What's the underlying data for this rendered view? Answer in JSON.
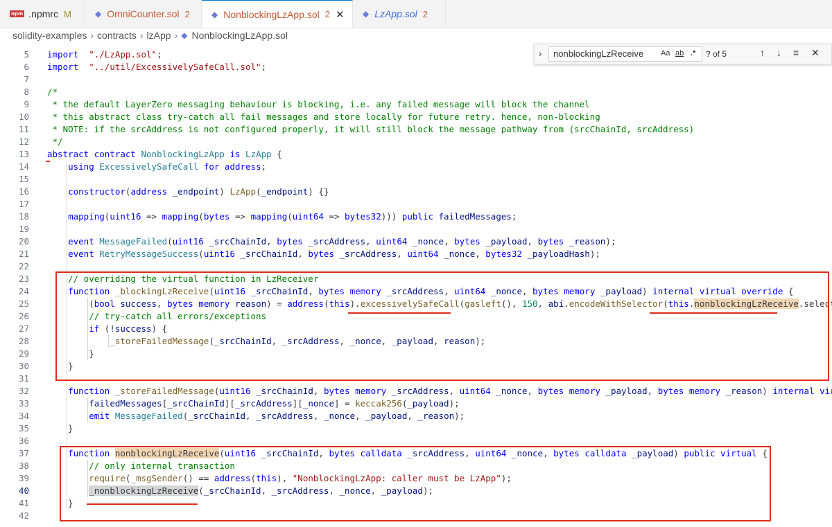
{
  "tabs": [
    {
      "icon": "npm-icon",
      "label": ".npmrc",
      "mod": "M"
    },
    {
      "icon": "solidity-icon",
      "label": "OmniCounter.sol",
      "mod": "2"
    },
    {
      "icon": "solidity-icon",
      "label": "NonblockingLzApp.sol",
      "mod": "2",
      "close": "✕"
    },
    {
      "icon": "solidity-icon",
      "label": "LzApp.sol",
      "mod": "2"
    }
  ],
  "breadcrumb": [
    "solidity-examples",
    "contracts",
    "lzApp",
    "NonblockingLzApp.sol"
  ],
  "find": {
    "query": "nonblockingLzReceive",
    "match_case": "Aa",
    "whole_word": "ab",
    "regex": ".*",
    "count": "? of 5"
  },
  "lines": [
    {
      "n": "5",
      "parts": [
        [
          "k",
          "import"
        ],
        [
          "",
          "  "
        ],
        [
          "s",
          "\"./LzApp.sol\""
        ],
        [
          "",
          ";"
        ]
      ]
    },
    {
      "n": "6",
      "parts": [
        [
          "k",
          "import"
        ],
        [
          "",
          "  "
        ],
        [
          "s",
          "\"../util/ExcessivelySafeCall.sol\""
        ],
        [
          "",
          ";"
        ]
      ]
    },
    {
      "n": "7",
      "parts": []
    },
    {
      "n": "8",
      "parts": [
        [
          "c",
          "/*"
        ]
      ]
    },
    {
      "n": "9",
      "parts": [
        [
          "c",
          " * the default LayerZero messaging behaviour is blocking, i.e. any failed message will block the channel"
        ]
      ]
    },
    {
      "n": "10",
      "parts": [
        [
          "c",
          " * this abstract class try-catch all fail messages and store locally for future retry. hence, non-blocking"
        ]
      ]
    },
    {
      "n": "11",
      "parts": [
        [
          "c",
          " * NOTE: if the srcAddress is not configured properly, it will still block the message pathway from (srcChainId, srcAddress)"
        ]
      ]
    },
    {
      "n": "12",
      "parts": [
        [
          "c",
          " */"
        ]
      ]
    },
    {
      "n": "13",
      "parts": [
        [
          "k",
          "abstract"
        ],
        [
          "",
          " "
        ],
        [
          "k",
          "contract"
        ],
        [
          "",
          " "
        ],
        [
          "t",
          "NonblockingLzApp"
        ],
        [
          "",
          " "
        ],
        [
          "k",
          "is"
        ],
        [
          "",
          " "
        ],
        [
          "t",
          "LzApp"
        ],
        [
          "",
          " {"
        ]
      ]
    },
    {
      "n": "14",
      "parts": [
        [
          "",
          "    "
        ],
        [
          "k",
          "using"
        ],
        [
          "",
          " "
        ],
        [
          "t",
          "ExcessivelySafeCall"
        ],
        [
          "",
          " "
        ],
        [
          "k",
          "for"
        ],
        [
          "",
          " "
        ],
        [
          "k",
          "address"
        ],
        [
          "",
          ";"
        ]
      ]
    },
    {
      "n": "15",
      "parts": []
    },
    {
      "n": "16",
      "parts": [
        [
          "",
          "    "
        ],
        [
          "k",
          "constructor"
        ],
        [
          "",
          "("
        ],
        [
          "k",
          "address"
        ],
        [
          "",
          " "
        ],
        [
          "p",
          "_endpoint"
        ],
        [
          "",
          ") "
        ],
        [
          "f",
          "LzApp"
        ],
        [
          "",
          "("
        ],
        [
          "p",
          "_endpoint"
        ],
        [
          "",
          ") {}"
        ]
      ]
    },
    {
      "n": "17",
      "parts": []
    },
    {
      "n": "18",
      "parts": [
        [
          "",
          "    "
        ],
        [
          "k",
          "mapping"
        ],
        [
          "",
          "("
        ],
        [
          "k",
          "uint16"
        ],
        [
          "",
          " => "
        ],
        [
          "k",
          "mapping"
        ],
        [
          "",
          "("
        ],
        [
          "k",
          "bytes"
        ],
        [
          "",
          " => "
        ],
        [
          "k",
          "mapping"
        ],
        [
          "",
          "("
        ],
        [
          "k",
          "uint64"
        ],
        [
          "",
          " => "
        ],
        [
          "k",
          "bytes32"
        ],
        [
          "",
          ")))"
        ],
        [
          "",
          " "
        ],
        [
          "k",
          "public"
        ],
        [
          "",
          " "
        ],
        [
          "p",
          "failedMessages"
        ],
        [
          "",
          ";"
        ]
      ]
    },
    {
      "n": "19",
      "parts": []
    },
    {
      "n": "20",
      "parts": [
        [
          "",
          "    "
        ],
        [
          "k",
          "event"
        ],
        [
          "",
          " "
        ],
        [
          "t",
          "MessageFailed"
        ],
        [
          "",
          "("
        ],
        [
          "k",
          "uint16"
        ],
        [
          "",
          " "
        ],
        [
          "p",
          "_srcChainId"
        ],
        [
          "",
          ", "
        ],
        [
          "k",
          "bytes"
        ],
        [
          "",
          " "
        ],
        [
          "p",
          "_srcAddress"
        ],
        [
          "",
          ", "
        ],
        [
          "k",
          "uint64"
        ],
        [
          "",
          " "
        ],
        [
          "p",
          "_nonce"
        ],
        [
          "",
          ", "
        ],
        [
          "k",
          "bytes"
        ],
        [
          "",
          " "
        ],
        [
          "p",
          "_payload"
        ],
        [
          "",
          ", "
        ],
        [
          "k",
          "bytes"
        ],
        [
          "",
          " "
        ],
        [
          "p",
          "_reason"
        ],
        [
          "",
          ");"
        ]
      ]
    },
    {
      "n": "21",
      "parts": [
        [
          "",
          "    "
        ],
        [
          "k",
          "event"
        ],
        [
          "",
          " "
        ],
        [
          "t",
          "RetryMessageSuccess"
        ],
        [
          "",
          "("
        ],
        [
          "k",
          "uint16"
        ],
        [
          "",
          " "
        ],
        [
          "p",
          "_srcChainId"
        ],
        [
          "",
          ", "
        ],
        [
          "k",
          "bytes"
        ],
        [
          "",
          " "
        ],
        [
          "p",
          "_srcAddress"
        ],
        [
          "",
          ", "
        ],
        [
          "k",
          "uint64"
        ],
        [
          "",
          " "
        ],
        [
          "p",
          "_nonce"
        ],
        [
          "",
          ", "
        ],
        [
          "k",
          "bytes32"
        ],
        [
          "",
          " "
        ],
        [
          "p",
          "_payloadHash"
        ],
        [
          "",
          ");"
        ]
      ]
    },
    {
      "n": "22",
      "parts": []
    },
    {
      "n": "23",
      "parts": [
        [
          "",
          "    "
        ],
        [
          "c",
          "// overriding the virtual function in LzReceiver"
        ]
      ]
    },
    {
      "n": "24",
      "parts": [
        [
          "",
          "    "
        ],
        [
          "k",
          "function"
        ],
        [
          "",
          " "
        ],
        [
          "f",
          "_blockingLzReceive"
        ],
        [
          "",
          "("
        ],
        [
          "k",
          "uint16"
        ],
        [
          "",
          " "
        ],
        [
          "p",
          "_srcChainId"
        ],
        [
          "",
          ", "
        ],
        [
          "k",
          "bytes"
        ],
        [
          "",
          " "
        ],
        [
          "k",
          "memory"
        ],
        [
          "",
          " "
        ],
        [
          "p",
          "_srcAddress"
        ],
        [
          "",
          ", "
        ],
        [
          "k",
          "uint64"
        ],
        [
          "",
          " "
        ],
        [
          "p",
          "_nonce"
        ],
        [
          "",
          ", "
        ],
        [
          "k",
          "bytes"
        ],
        [
          "",
          " "
        ],
        [
          "k",
          "memory"
        ],
        [
          "",
          " "
        ],
        [
          "p",
          "_payload"
        ],
        [
          "",
          ") "
        ],
        [
          "k",
          "internal"
        ],
        [
          "",
          " "
        ],
        [
          "k",
          "virtual"
        ],
        [
          "",
          " "
        ],
        [
          "k",
          "override"
        ],
        [
          "",
          " {"
        ]
      ]
    },
    {
      "n": "25",
      "parts": [
        [
          "",
          "        ("
        ],
        [
          "k",
          "bool"
        ],
        [
          "",
          " "
        ],
        [
          "p",
          "success"
        ],
        [
          "",
          ", "
        ],
        [
          "k",
          "bytes"
        ],
        [
          "",
          " "
        ],
        [
          "k",
          "memory"
        ],
        [
          "",
          " "
        ],
        [
          "p",
          "reason"
        ],
        [
          "",
          ") = "
        ],
        [
          "k",
          "address"
        ],
        [
          "",
          "("
        ],
        [
          "k",
          "this"
        ],
        [
          "",
          ")."
        ],
        [
          "f",
          "excessivelySafeCall"
        ],
        [
          "",
          "("
        ],
        [
          "f",
          "gasleft"
        ],
        [
          "",
          "(), "
        ],
        [
          "n",
          "150"
        ],
        [
          "",
          ", "
        ],
        [
          "p",
          "abi"
        ],
        [
          "",
          "."
        ],
        [
          "f",
          "encodeWithSelector"
        ],
        [
          "",
          "("
        ],
        [
          "k",
          "this"
        ],
        [
          "",
          "."
        ],
        [
          "hl",
          "nonblockingLzReceive"
        ],
        [
          "",
          ".selector, _"
        ]
      ]
    },
    {
      "n": "26",
      "parts": [
        [
          "",
          "        "
        ],
        [
          "c",
          "// try-catch all errors/exceptions"
        ]
      ]
    },
    {
      "n": "27",
      "parts": [
        [
          "",
          "        "
        ],
        [
          "k",
          "if"
        ],
        [
          "",
          " (!"
        ],
        [
          "p",
          "success"
        ],
        [
          "",
          ") {"
        ]
      ]
    },
    {
      "n": "28",
      "parts": [
        [
          "",
          "            "
        ],
        [
          "f",
          "_storeFailedMessage"
        ],
        [
          "",
          "("
        ],
        [
          "p",
          "_srcChainId"
        ],
        [
          "",
          ", "
        ],
        [
          "p",
          "_srcAddress"
        ],
        [
          "",
          ", "
        ],
        [
          "p",
          "_nonce"
        ],
        [
          "",
          ", "
        ],
        [
          "p",
          "_payload"
        ],
        [
          "",
          ", "
        ],
        [
          "p",
          "reason"
        ],
        [
          "",
          ");"
        ]
      ]
    },
    {
      "n": "29",
      "parts": [
        [
          "",
          "        }"
        ]
      ]
    },
    {
      "n": "30",
      "parts": [
        [
          "",
          "    }"
        ]
      ]
    },
    {
      "n": "31",
      "parts": []
    },
    {
      "n": "32",
      "parts": [
        [
          "",
          "    "
        ],
        [
          "k",
          "function"
        ],
        [
          "",
          " "
        ],
        [
          "f",
          "_storeFailedMessage"
        ],
        [
          "",
          "("
        ],
        [
          "k",
          "uint16"
        ],
        [
          "",
          " "
        ],
        [
          "p",
          "_srcChainId"
        ],
        [
          "",
          ", "
        ],
        [
          "k",
          "bytes"
        ],
        [
          "",
          " "
        ],
        [
          "k",
          "memory"
        ],
        [
          "",
          " "
        ],
        [
          "p",
          "_srcAddress"
        ],
        [
          "",
          ", "
        ],
        [
          "k",
          "uint64"
        ],
        [
          "",
          " "
        ],
        [
          "p",
          "_nonce"
        ],
        [
          "",
          ", "
        ],
        [
          "k",
          "bytes"
        ],
        [
          "",
          " "
        ],
        [
          "k",
          "memory"
        ],
        [
          "",
          " "
        ],
        [
          "p",
          "_payload"
        ],
        [
          "",
          ", "
        ],
        [
          "k",
          "bytes"
        ],
        [
          "",
          " "
        ],
        [
          "k",
          "memory"
        ],
        [
          "",
          " "
        ],
        [
          "p",
          "_reason"
        ],
        [
          "",
          ") "
        ],
        [
          "k",
          "internal"
        ],
        [
          "",
          " "
        ],
        [
          "k",
          "virtual"
        ]
      ]
    },
    {
      "n": "33",
      "parts": [
        [
          "",
          "        "
        ],
        [
          "p",
          "failedMessages"
        ],
        [
          "",
          "["
        ],
        [
          "p",
          "_srcChainId"
        ],
        [
          "",
          "]["
        ],
        [
          "p",
          "_srcAddress"
        ],
        [
          "",
          "]["
        ],
        [
          "p",
          "_nonce"
        ],
        [
          "",
          "] = "
        ],
        [
          "f",
          "keccak256"
        ],
        [
          "",
          "("
        ],
        [
          "p",
          "_payload"
        ],
        [
          "",
          ");"
        ]
      ]
    },
    {
      "n": "34",
      "parts": [
        [
          "",
          "        "
        ],
        [
          "k",
          "emit"
        ],
        [
          "",
          " "
        ],
        [
          "t",
          "MessageFailed"
        ],
        [
          "",
          "("
        ],
        [
          "p",
          "_srcChainId"
        ],
        [
          "",
          ", "
        ],
        [
          "p",
          "_srcAddress"
        ],
        [
          "",
          ", "
        ],
        [
          "p",
          "_nonce"
        ],
        [
          "",
          ", "
        ],
        [
          "p",
          "_payload"
        ],
        [
          "",
          ", "
        ],
        [
          "p",
          "_reason"
        ],
        [
          "",
          ");"
        ]
      ]
    },
    {
      "n": "35",
      "parts": [
        [
          "",
          "    }"
        ]
      ]
    },
    {
      "n": "36",
      "parts": []
    },
    {
      "n": "37",
      "parts": [
        [
          "",
          "    "
        ],
        [
          "k",
          "function"
        ],
        [
          "",
          " "
        ],
        [
          "hl",
          "nonblockingLzReceive"
        ],
        [
          "",
          "("
        ],
        [
          "k",
          "uint16"
        ],
        [
          "",
          " "
        ],
        [
          "p",
          "_srcChainId"
        ],
        [
          "",
          ", "
        ],
        [
          "k",
          "bytes"
        ],
        [
          "",
          " "
        ],
        [
          "k",
          "calldata"
        ],
        [
          "",
          " "
        ],
        [
          "p",
          "_srcAddress"
        ],
        [
          "",
          ", "
        ],
        [
          "k",
          "uint64"
        ],
        [
          "",
          " "
        ],
        [
          "p",
          "_nonce"
        ],
        [
          "",
          ", "
        ],
        [
          "k",
          "bytes"
        ],
        [
          "",
          " "
        ],
        [
          "k",
          "calldata"
        ],
        [
          "",
          " "
        ],
        [
          "p",
          "_payload"
        ],
        [
          "",
          ") "
        ],
        [
          "k",
          "public"
        ],
        [
          "",
          " "
        ],
        [
          "k",
          "virtual"
        ],
        [
          "",
          " {"
        ]
      ]
    },
    {
      "n": "38",
      "parts": [
        [
          "",
          "        "
        ],
        [
          "c",
          "// only internal transaction"
        ]
      ]
    },
    {
      "n": "39",
      "parts": [
        [
          "",
          "        "
        ],
        [
          "f",
          "require"
        ],
        [
          "",
          "("
        ],
        [
          "f",
          "_msgSender"
        ],
        [
          "",
          "() == "
        ],
        [
          "k",
          "address"
        ],
        [
          "",
          "("
        ],
        [
          "k",
          "this"
        ],
        [
          "",
          "), "
        ],
        [
          "s",
          "\"NonblockingLzApp: caller must be LzApp\""
        ],
        [
          "",
          ");"
        ]
      ]
    },
    {
      "n": "40",
      "parts": [
        [
          "",
          "        "
        ],
        [
          "hlw",
          "_nonblockingLzReceive"
        ],
        [
          "",
          "("
        ],
        [
          "p",
          "_srcChainId"
        ],
        [
          "",
          ", "
        ],
        [
          "p",
          "_srcAddress"
        ],
        [
          "",
          ", "
        ],
        [
          "p",
          "_nonce"
        ],
        [
          "",
          ", "
        ],
        [
          "p",
          "_payload"
        ],
        [
          "",
          ");"
        ]
      ]
    },
    {
      "n": "41",
      "parts": [
        [
          "",
          "    }"
        ]
      ]
    },
    {
      "n": "42",
      "parts": []
    }
  ]
}
